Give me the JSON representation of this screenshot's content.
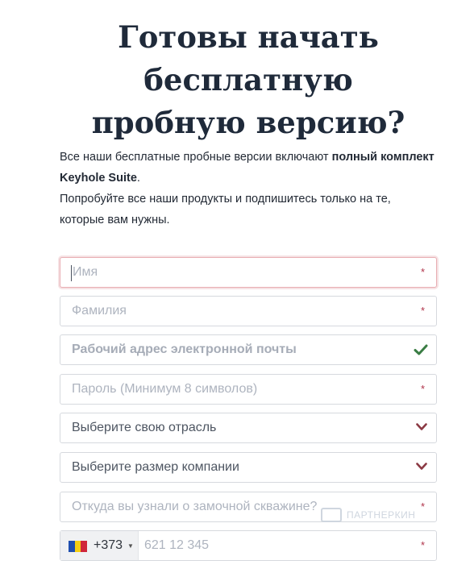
{
  "heading": {
    "line1": "Готовы начать",
    "line2": "бесплатную",
    "line3": "пробную версию?"
  },
  "intro": {
    "p1_text": "Все наши бесплатные пробные версии включают ",
    "p1_bold": "полный комплект Keyhole Suite",
    "p1_end": ".",
    "p2_text": "Попробуйте все наши продукты и подпишитесь только на те, которые вам нужны."
  },
  "form": {
    "first_name": {
      "placeholder": "Имя",
      "required_mark": "*"
    },
    "last_name": {
      "placeholder": "Фамилия",
      "required_mark": "*"
    },
    "email": {
      "placeholder": "Рабочий адрес электронной почты",
      "status_icon": "check-icon",
      "status_color": "#3a7d44"
    },
    "password": {
      "placeholder": "Пароль (Минимум 8 символов)",
      "required_mark": "*"
    },
    "industry": {
      "value": "Выберите свою отрасль",
      "icon": "chevron-down-icon"
    },
    "company_size": {
      "value": "Выберите размер компании",
      "icon": "chevron-down-icon"
    },
    "referral": {
      "placeholder": "Откуда вы узнали о замочной скважине?",
      "required_mark": "*"
    },
    "phone": {
      "country_code": "+373",
      "flag": "moldova-flag-icon",
      "placeholder": "621 12 345",
      "required_mark": "*"
    }
  },
  "watermark": {
    "text": "ПАРТНЕРКИН"
  },
  "colors": {
    "heading": "#1f2a3a",
    "required": "#b0334a",
    "chevron": "#8b3a44",
    "focus_border": "#e8aeb3"
  }
}
